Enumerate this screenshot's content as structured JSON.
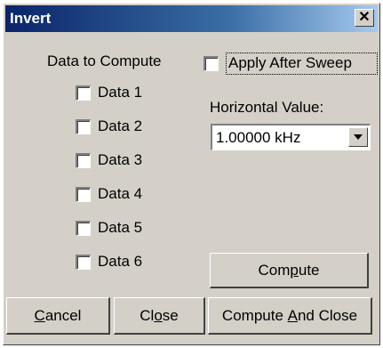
{
  "window": {
    "title": "Invert",
    "close_glyph": "✕",
    "close_icon": "close-icon"
  },
  "data_section": {
    "heading": "Data to Compute",
    "items": [
      {
        "label": "Data 1",
        "checked": false
      },
      {
        "label": "Data 2",
        "checked": false
      },
      {
        "label": "Data 3",
        "checked": false
      },
      {
        "label": "Data 4",
        "checked": false
      },
      {
        "label": "Data 5",
        "checked": false
      },
      {
        "label": "Data 6",
        "checked": false
      }
    ]
  },
  "apply_after_sweep": {
    "label": "Apply After Sweep",
    "checked": false
  },
  "horizontal_value": {
    "label": "Horizontal Value:",
    "selected": "1.00000 kHz",
    "arrow_icon": "chevron-down-icon"
  },
  "buttons": {
    "compute": {
      "pre": "Com",
      "mnemonic": "p",
      "post": "ute"
    },
    "cancel": {
      "pre": "",
      "mnemonic": "C",
      "post": "ancel"
    },
    "close": {
      "pre": "Cl",
      "mnemonic": "o",
      "post": "se"
    },
    "compute_and_close": {
      "pre": "Compute ",
      "mnemonic": "A",
      "post": "nd Close"
    }
  },
  "colors": {
    "face": "#d4d0c8",
    "title_start": "#0a246a",
    "title_end": "#a6caf0"
  }
}
